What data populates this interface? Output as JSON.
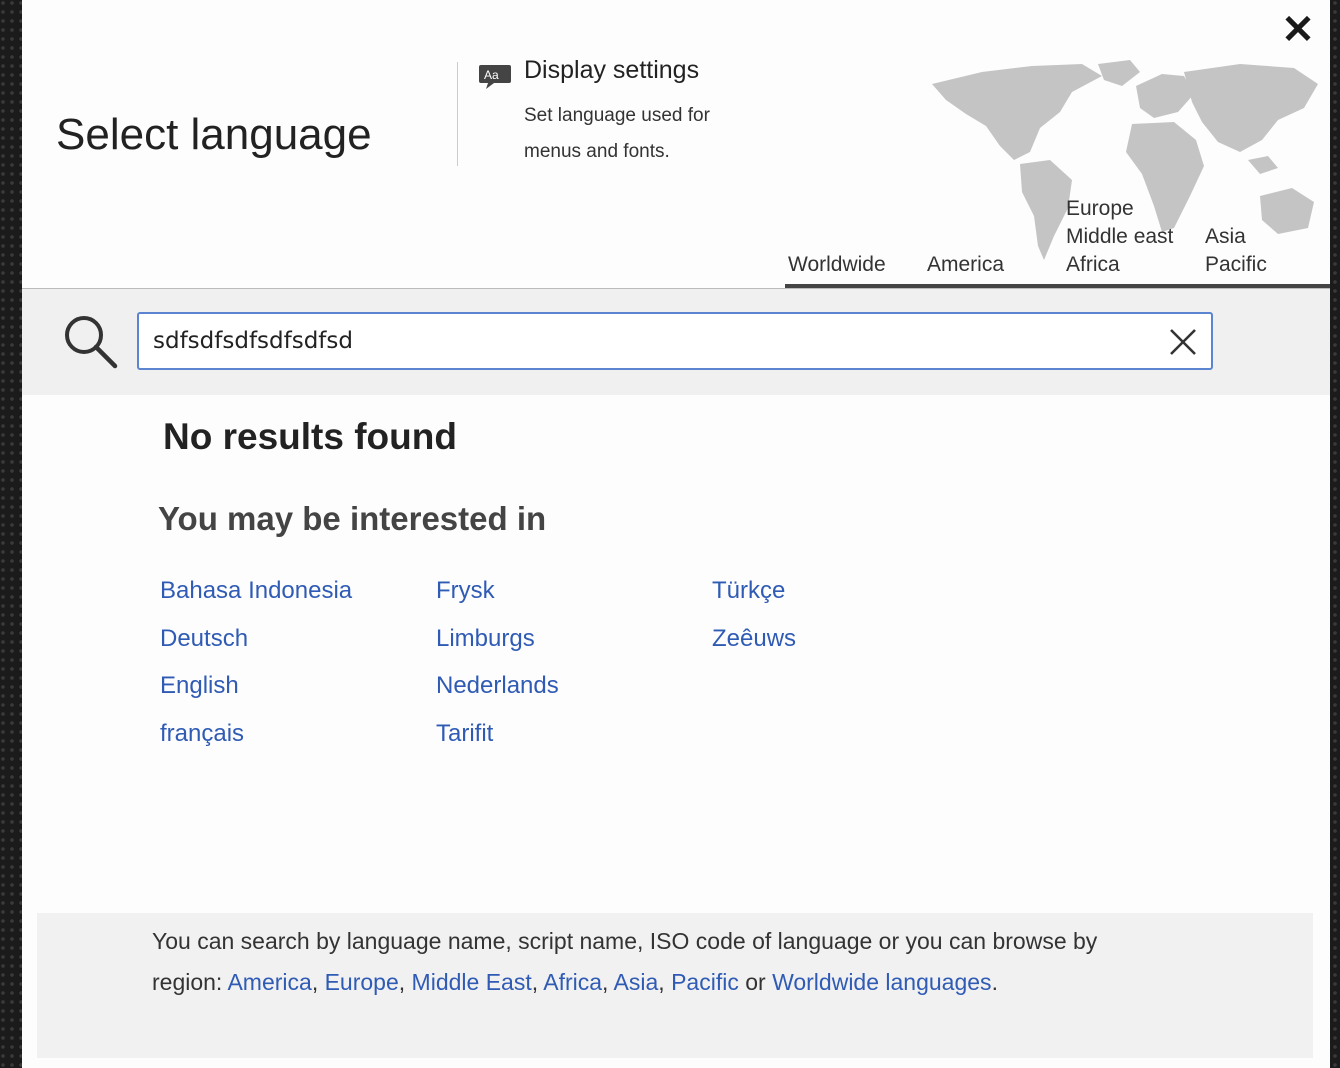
{
  "dialog": {
    "close_label": "✕",
    "title": "Select language"
  },
  "display_settings": {
    "icon": "display-settings-icon",
    "title": "Display settings",
    "description": "Set language used for menus and fonts."
  },
  "regions": {
    "worldwide": "Worldwide",
    "america": "America",
    "emea_1": "Europe",
    "emea_2": "Middle east",
    "emea_3": "Africa",
    "apac_1": "Asia",
    "apac_2": "Pacific"
  },
  "search": {
    "value": "sdfsdfsdfsdfsdfsd",
    "search_icon": "search-icon",
    "clear_icon": "clear-icon"
  },
  "results": {
    "no_results": "No results found",
    "interested_heading": "You may be interested in",
    "columns": [
      [
        "Bahasa Indonesia",
        "Deutsch",
        "English",
        "français"
      ],
      [
        "Frysk",
        "Limburgs",
        "Nederlands",
        "Tarifit"
      ],
      [
        "Türkçe",
        "Zeêuws"
      ]
    ]
  },
  "info": {
    "text_1": "You can search by language name, script name, ISO code of language or you can browse by region: ",
    "link_america": "America",
    "sep_1": ", ",
    "link_europe": "Europe",
    "sep_2": ", ",
    "link_middle_east": "Middle East",
    "sep_3": ", ",
    "link_africa": "Africa",
    "sep_4": ", ",
    "link_asia": "Asia",
    "sep_5": ", ",
    "link_pacific": "Pacific",
    "text_or": " or ",
    "link_worldwide": "Worldwide languages",
    "text_end": "."
  },
  "colors": {
    "link": "#2f5bb5",
    "input_border": "#5b84d1",
    "map": "#c4c4c4"
  }
}
